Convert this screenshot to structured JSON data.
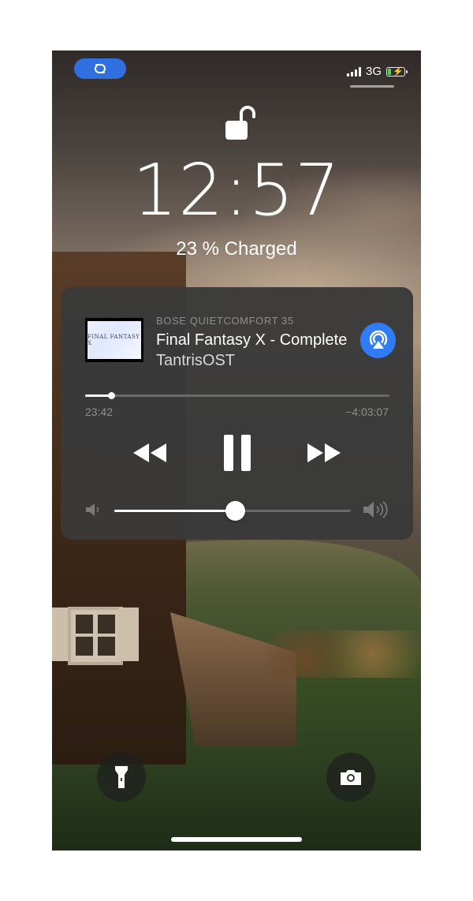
{
  "status_bar": {
    "network": "3G",
    "battery_percent": 23,
    "battery_fill_color": "#48d35a",
    "pill_color": "#2f6fe0",
    "pill_icon": "link-icon"
  },
  "lock_screen": {
    "lock_icon": "unlocked-padlock-icon",
    "time": "12:57",
    "charge_status": "23 % Charged"
  },
  "media": {
    "album_art_text": "FINAL FANTASY X",
    "device": "BOSE QUIETCOMFORT 35",
    "title": "Final Fantasy X - Complete",
    "artist": "TantrisOST",
    "elapsed": "23:42",
    "remaining": "−4:03:07",
    "progress_fraction": 0.088,
    "volume_fraction": 0.51,
    "airplay_icon": "airplay-audio-icon",
    "airplay_color": "#2f7cf6",
    "controls": [
      "rewind-icon",
      "pause-icon",
      "fast-forward-icon"
    ]
  },
  "quick_actions": {
    "left": "flashlight-icon",
    "right": "camera-icon"
  }
}
